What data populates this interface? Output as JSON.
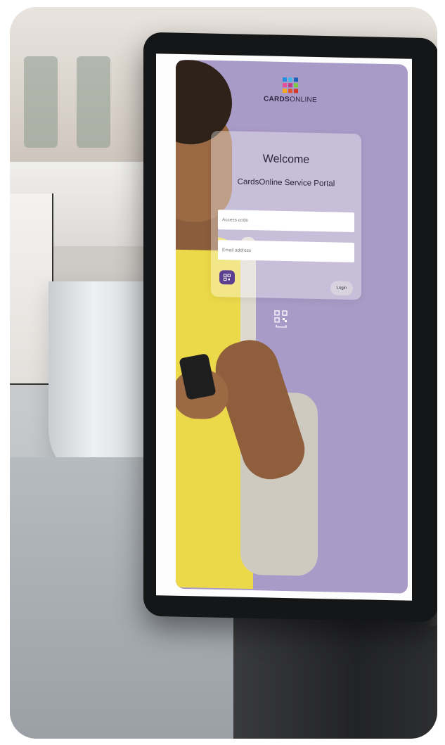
{
  "brand": {
    "name_bold": "CARDS",
    "name_light": "ONLINE",
    "logo_colors": [
      "#2a8ee0",
      "#47b6e8",
      "#1e5fb8",
      "#e84f9b",
      "#c03a8e",
      "#7ac943",
      "#f6a623",
      "#e3522b",
      "#d6352b"
    ]
  },
  "login": {
    "welcome": "Welcome",
    "subtitle": "CardsOnline Service Portal",
    "access_code_placeholder": "Access code",
    "email_placeholder": "Email address",
    "login_label": "Login"
  },
  "icons": {
    "qr_button": "qr-scan-icon",
    "qr_floating": "qr-scan-icon"
  },
  "colors": {
    "screen_bg": "#a99bc7",
    "accent": "#5d3f92",
    "button_bg": "#d6d3de"
  }
}
